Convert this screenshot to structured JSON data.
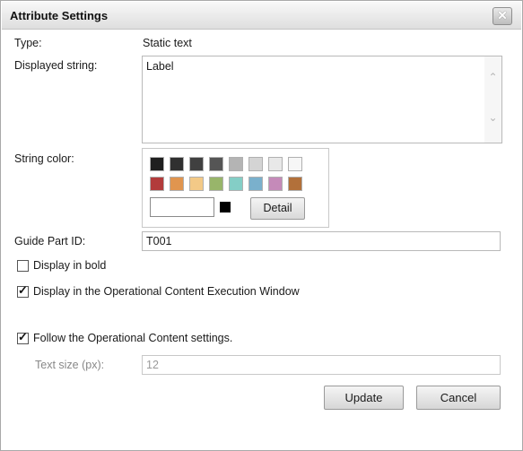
{
  "dialog": {
    "title": "Attribute Settings",
    "close_glyph": "✕"
  },
  "fields": {
    "type_label": "Type:",
    "type_value": "Static text",
    "displayed_string_label": "Displayed string:",
    "displayed_string_value": "Label",
    "string_color_label": "String color:",
    "detail_label": "Detail",
    "guide_part_id_label": "Guide Part ID:",
    "guide_part_id_value": "T001",
    "text_size_label": "Text size (px):",
    "text_size_value": "12"
  },
  "palette": {
    "colors_row1": [
      "#1f1f1f",
      "#303030",
      "#404040",
      "#555555",
      "#b4b4b4",
      "#d4d4d4",
      "#e8e8e8",
      "#f6f6f6"
    ],
    "colors_row2": [
      "#b23b3b",
      "#e0954f",
      "#f3c987",
      "#98b56a",
      "#84cec6",
      "#7ab0cc",
      "#c58ab9",
      "#b2703a"
    ],
    "selected_color": "#000000"
  },
  "options": {
    "bold": {
      "label": "Display in bold",
      "checked": false
    },
    "exec_window": {
      "label": "Display in the Operational Content Execution Window",
      "checked": true
    },
    "follow_settings": {
      "label": "Follow the Operational Content settings.",
      "checked": true
    }
  },
  "buttons": {
    "update": "Update",
    "cancel": "Cancel"
  },
  "icons": {
    "close": "close-icon",
    "check": "check-icon",
    "scroll_up": "chevron-up-icon",
    "scroll_down": "chevron-down-icon"
  }
}
